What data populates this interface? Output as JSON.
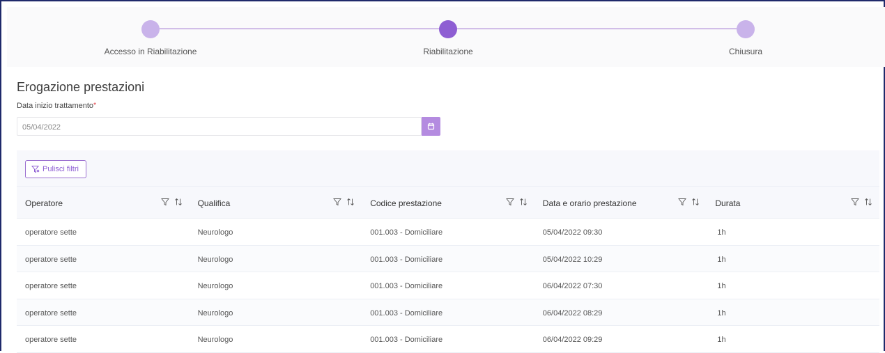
{
  "stepper": {
    "steps": [
      {
        "label": "Accesso in Riabilitazione",
        "state": "done"
      },
      {
        "label": "Riabilitazione",
        "state": "active"
      },
      {
        "label": "Chiusura",
        "state": "todo"
      }
    ]
  },
  "section": {
    "title": "Erogazione prestazioni",
    "date_label": "Data inizio trattamento",
    "required_mark": "*",
    "date_value": "05/04/2022"
  },
  "toolbar": {
    "clear_filters_label": "Pulisci filtri"
  },
  "table": {
    "columns": [
      "Operatore",
      "Qualifica",
      "Codice prestazione",
      "Data e orario prestazione",
      "Durata"
    ],
    "rows": [
      [
        "operatore sette",
        "Neurologo",
        "001.003 - Domiciliare",
        "05/04/2022 09:30",
        "1h"
      ],
      [
        "operatore sette",
        "Neurologo",
        "001.003 - Domiciliare",
        "05/04/2022 10:29",
        "1h"
      ],
      [
        "operatore sette",
        "Neurologo",
        "001.003 - Domiciliare",
        "06/04/2022 07:30",
        "1h"
      ],
      [
        "operatore sette",
        "Neurologo",
        "001.003 - Domiciliare",
        "06/04/2022 08:29",
        "1h"
      ],
      [
        "operatore sette",
        "Neurologo",
        "001.003 - Domiciliare",
        "06/04/2022 09:29",
        "1h"
      ]
    ]
  },
  "colors": {
    "accent": "#8e5ed3",
    "accent_light": "#c9b3ea",
    "required": "#e0383e"
  },
  "icons": [
    "calendar-icon",
    "filter-icon",
    "sort-icon",
    "clear-filter-icon"
  ]
}
